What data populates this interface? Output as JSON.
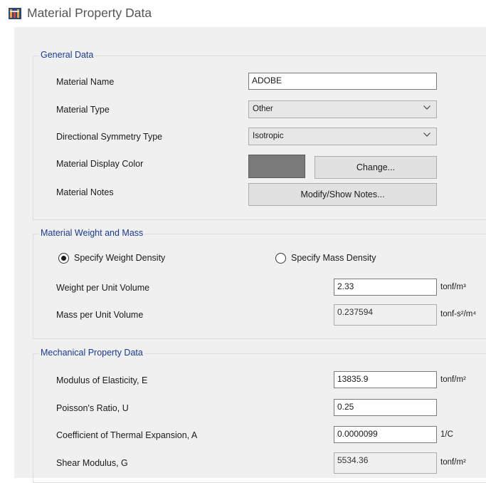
{
  "window": {
    "title": "Material Property Data",
    "icon": "etabs-app-icon"
  },
  "general": {
    "group_title": "General Data",
    "material_name_label": "Material Name",
    "material_name_value": "ADOBE",
    "material_type_label": "Material Type",
    "material_type_value": "Other",
    "symmetry_label": "Directional Symmetry Type",
    "symmetry_value": "Isotropic",
    "display_color_label": "Material Display Color",
    "display_color": "#7a7a7a",
    "change_button": "Change...",
    "notes_label": "Material Notes",
    "notes_button": "Modify/Show Notes..."
  },
  "weight_mass": {
    "group_title": "Material Weight and Mass",
    "radio_weight": "Specify Weight Density",
    "radio_mass": "Specify Mass Density",
    "selected": "weight",
    "weight_label": "Weight per Unit Volume",
    "weight_value": "2.33",
    "weight_unit": "tonf/m³",
    "mass_label": "Mass per Unit Volume",
    "mass_value": "0.237594",
    "mass_unit": "tonf-s²/m⁴"
  },
  "mechanical": {
    "group_title": "Mechanical Property Data",
    "e_label": "Modulus of Elasticity,  E",
    "e_value": "13835.9",
    "e_unit": "tonf/m²",
    "u_label": "Poisson's Ratio,  U",
    "u_value": "0.25",
    "a_label": "Coefficient of Thermal Expansion,  A",
    "a_value": "0.0000099",
    "a_unit": "1/C",
    "g_label": "Shear Modulus,  G",
    "g_value": "5534.36",
    "g_unit": "tonf/m²"
  }
}
